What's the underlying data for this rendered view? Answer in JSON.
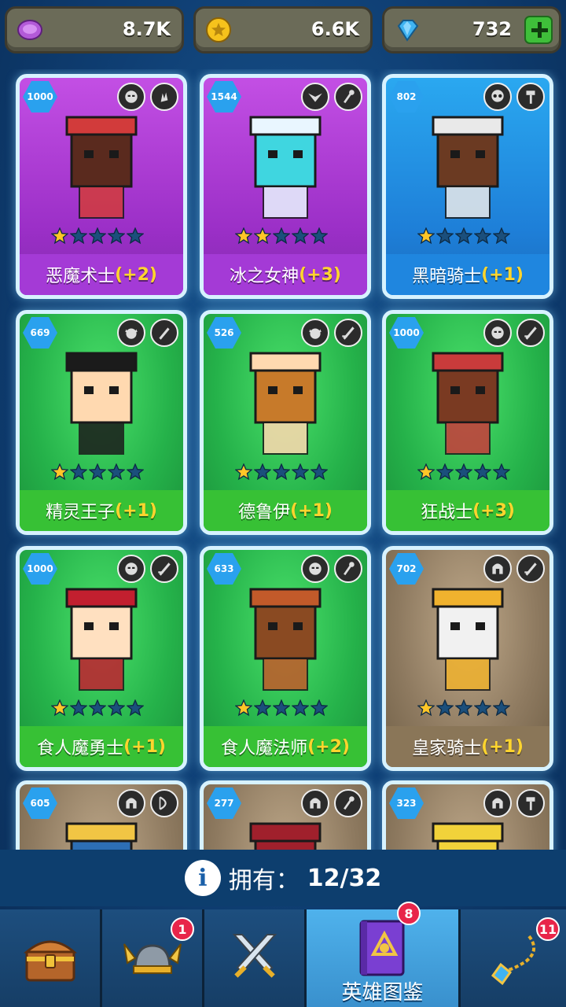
{
  "currencies": {
    "purple_coin": {
      "value": "8.7K",
      "icon": "purple-coin-icon"
    },
    "gold_coin": {
      "value": "6.6K",
      "icon": "gold-coin-icon"
    },
    "gem": {
      "value": "732",
      "icon": "blue-gem-icon",
      "add_icon": "plus-icon"
    }
  },
  "heroes": [
    {
      "level": "1000",
      "name": "恶魔术士",
      "bonus": "(+2)",
      "stars": 1,
      "theme": "purple",
      "badges": [
        "orc-head-icon",
        "magic-hand-icon"
      ]
    },
    {
      "level": "1544",
      "name": "冰之女神",
      "bonus": "(+3)",
      "stars": 2,
      "theme": "purple",
      "badges": [
        "winged-emblem-icon",
        "staff-icon"
      ]
    },
    {
      "level": "802",
      "name": "黑暗骑士",
      "bonus": "(+1)",
      "stars": 1,
      "theme": "blue",
      "badges": [
        "skull-icon",
        "hammer-icon"
      ]
    },
    {
      "level": "669",
      "name": "精灵王子",
      "bonus": "(+1)",
      "stars": 1,
      "theme": "green",
      "badges": [
        "elf-head-icon",
        "dagger-icon"
      ]
    },
    {
      "level": "526",
      "name": "德鲁伊",
      "bonus": "(+1)",
      "stars": 1,
      "theme": "green",
      "badges": [
        "elf-head-icon",
        "sword-icon"
      ]
    },
    {
      "level": "1000",
      "name": "狂战士",
      "bonus": "(+3)",
      "stars": 1,
      "theme": "green",
      "badges": [
        "orc-head-icon",
        "sword-icon"
      ]
    },
    {
      "level": "1000",
      "name": "食人魔勇士",
      "bonus": "(+1)",
      "stars": 1,
      "theme": "green",
      "badges": [
        "orc-head-icon",
        "sword-icon"
      ]
    },
    {
      "level": "633",
      "name": "食人魔法师",
      "bonus": "(+2)",
      "stars": 1,
      "theme": "green",
      "badges": [
        "orc-head-icon",
        "staff-icon"
      ]
    },
    {
      "level": "702",
      "name": "皇家骑士",
      "bonus": "(+1)",
      "stars": 1,
      "theme": "tan",
      "badges": [
        "helmet-icon",
        "sword-icon"
      ]
    },
    {
      "level": "605",
      "name": "",
      "bonus": "",
      "stars": 0,
      "theme": "tan",
      "badges": [
        "helmet-icon",
        "bow-icon"
      ]
    },
    {
      "level": "277",
      "name": "",
      "bonus": "",
      "stars": 0,
      "theme": "tan",
      "badges": [
        "helmet-icon",
        "staff-icon"
      ]
    },
    {
      "level": "323",
      "name": "",
      "bonus": "",
      "stars": 0,
      "theme": "tan",
      "badges": [
        "helmet-icon",
        "hammer-icon"
      ]
    }
  ],
  "owned": {
    "label": "拥有：",
    "count": "12/32",
    "icon": "info-icon"
  },
  "nav": [
    {
      "icon": "treasure-chest-icon",
      "label": "",
      "badge": ""
    },
    {
      "icon": "viking-helmet-icon",
      "label": "",
      "badge": "1"
    },
    {
      "icon": "crossed-swords-icon",
      "label": "",
      "badge": ""
    },
    {
      "icon": "hero-book-icon",
      "label": "英雄图鉴",
      "badge": "8",
      "active": true
    },
    {
      "icon": "amulet-icon",
      "label": "",
      "badge": "11"
    }
  ],
  "colors": {
    "accent_gold": "#ffd52e",
    "notif_red": "#e8254a",
    "active_tab": "#4fb2ec"
  }
}
